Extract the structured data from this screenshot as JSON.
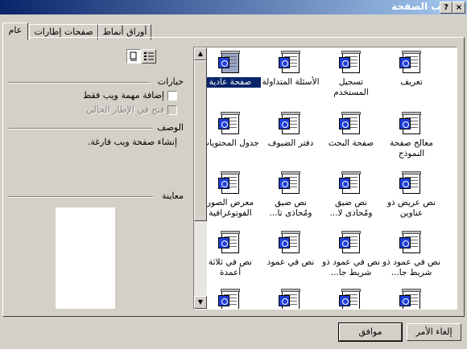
{
  "window": {
    "title": "قوالب الصفحة",
    "help_button": "?",
    "close_button": "×"
  },
  "tabs": [
    {
      "label": "عام"
    },
    {
      "label": "صفحات إطارات"
    },
    {
      "label": "أوراق أنماط"
    }
  ],
  "templates": [
    {
      "label": "تعريف"
    },
    {
      "label": "تسجيل المستخدم"
    },
    {
      "label": "الأسئلة المتداولة"
    },
    {
      "label": "صفحة عادية"
    },
    {
      "label": "معالج صفحة النموذج"
    },
    {
      "label": "صفحة البحث"
    },
    {
      "label": "دفتر الضيوف"
    },
    {
      "label": "جدول المحتويات"
    },
    {
      "label": "نص عريض ذو عناوين"
    },
    {
      "label": "نص ضيق ومُحاذى لا..."
    },
    {
      "label": "نص ضيق ومُحاذى تا..."
    },
    {
      "label": "معرض الصور الفوتوغرافية"
    },
    {
      "label": "نص في عمود ذو شريط جا..."
    },
    {
      "label": "نص في عمود ذو شريط جا..."
    },
    {
      "label": "نص في عمود"
    },
    {
      "label": "نص في ثلاثة أعمدة"
    }
  ],
  "options": {
    "heading": "خيارات",
    "add_task": "إضافة مهمة ويب فقط",
    "open_in_frame": "فتح في الإطار الحالي"
  },
  "description": {
    "heading": "الوصف",
    "text": "إنشاء صفحة ويب فارغة."
  },
  "preview": {
    "heading": "معاينة"
  },
  "buttons": {
    "ok": "موافق",
    "cancel": "إلغاء الأمر"
  },
  "view_icons": [
    "large-icons-view-icon",
    "list-view-icon"
  ]
}
